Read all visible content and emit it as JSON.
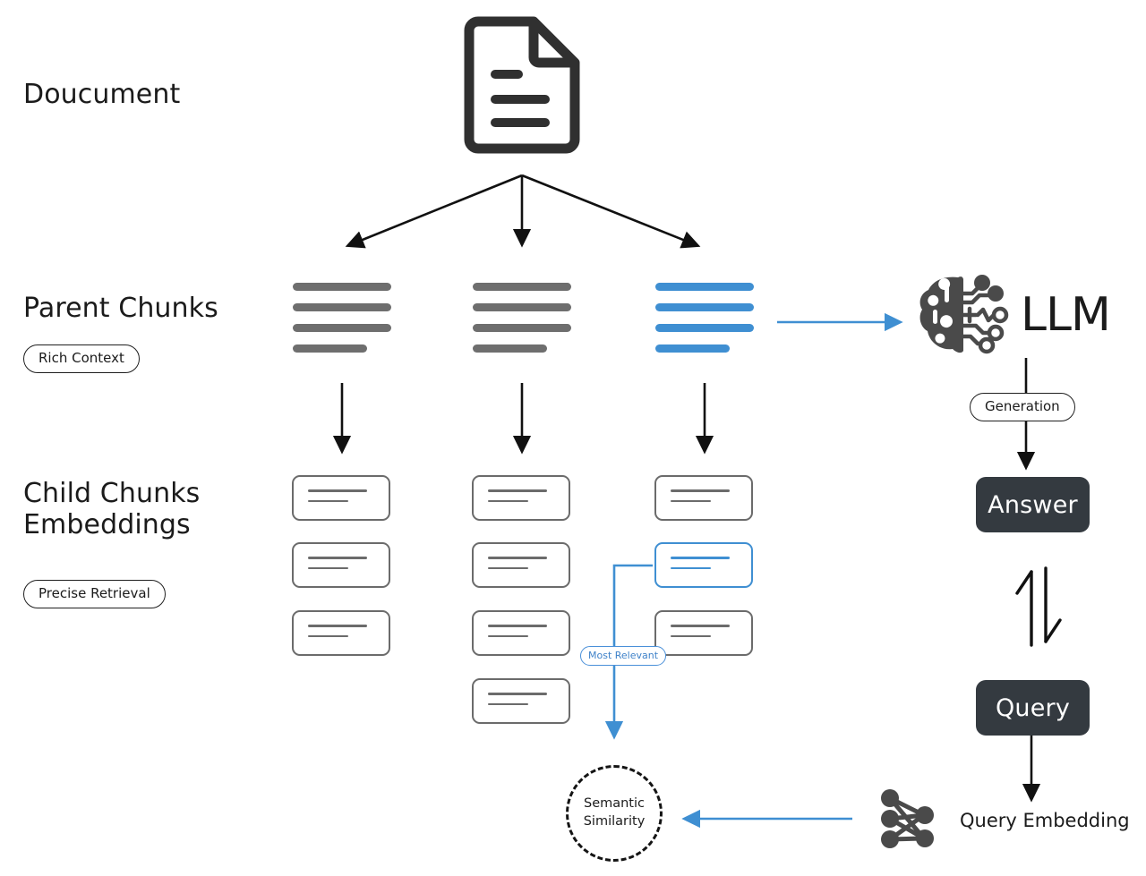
{
  "diagram": {
    "title_rows": {
      "document": "Doucument",
      "parent": "Parent Chunks",
      "child": "Child Chunks\nEmbeddings"
    },
    "badges": {
      "rich_context": "Rich Context",
      "precise_retrieval": "Precise Retrieval",
      "most_relevant": "Most Relevant",
      "generation": "Generation"
    },
    "right_column": {
      "llm_label": "LLM",
      "answer_label": "Answer",
      "query_label": "Query",
      "query_embedding_label": "Query Embedding"
    },
    "similarity_node": {
      "line1": "Semantic",
      "line2": "Similarity"
    },
    "icons": {
      "document": "document-icon",
      "llm_brain": "brain-circuit-icon",
      "neural_net": "neural-network-icon",
      "exchange": "bidirectional-arrow-icon"
    },
    "colors": {
      "accent_blue": "#3f8fd2",
      "gray": "#6e6e6e",
      "dark": "#343a40",
      "ink": "#1b1b1b",
      "background": "#ffffff"
    },
    "parent_chunks": [
      {
        "id": "parent-1",
        "lines": 4,
        "highlighted": false
      },
      {
        "id": "parent-2",
        "lines": 4,
        "highlighted": false
      },
      {
        "id": "parent-3",
        "lines": 4,
        "highlighted": true
      }
    ],
    "child_chunk_columns": [
      {
        "id": "child-col-1",
        "count": 3,
        "selected_index": -1
      },
      {
        "id": "child-col-2",
        "count": 4,
        "selected_index": -1
      },
      {
        "id": "child-col-3",
        "count": 3,
        "selected_index": 1
      }
    ]
  }
}
